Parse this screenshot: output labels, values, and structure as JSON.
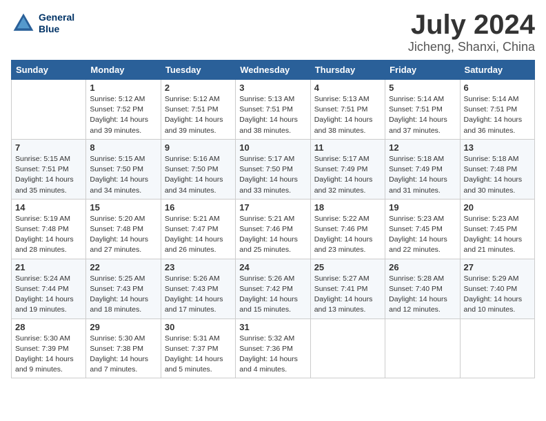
{
  "header": {
    "logo": {
      "line1": "General",
      "line2": "Blue"
    },
    "month": "July 2024",
    "location": "Jicheng, Shanxi, China"
  },
  "weekdays": [
    "Sunday",
    "Monday",
    "Tuesday",
    "Wednesday",
    "Thursday",
    "Friday",
    "Saturday"
  ],
  "weeks": [
    [
      {
        "day": "",
        "sunrise": "",
        "sunset": "",
        "daylight": ""
      },
      {
        "day": "1",
        "sunrise": "Sunrise: 5:12 AM",
        "sunset": "Sunset: 7:52 PM",
        "daylight": "Daylight: 14 hours and 39 minutes."
      },
      {
        "day": "2",
        "sunrise": "Sunrise: 5:12 AM",
        "sunset": "Sunset: 7:51 PM",
        "daylight": "Daylight: 14 hours and 39 minutes."
      },
      {
        "day": "3",
        "sunrise": "Sunrise: 5:13 AM",
        "sunset": "Sunset: 7:51 PM",
        "daylight": "Daylight: 14 hours and 38 minutes."
      },
      {
        "day": "4",
        "sunrise": "Sunrise: 5:13 AM",
        "sunset": "Sunset: 7:51 PM",
        "daylight": "Daylight: 14 hours and 38 minutes."
      },
      {
        "day": "5",
        "sunrise": "Sunrise: 5:14 AM",
        "sunset": "Sunset: 7:51 PM",
        "daylight": "Daylight: 14 hours and 37 minutes."
      },
      {
        "day": "6",
        "sunrise": "Sunrise: 5:14 AM",
        "sunset": "Sunset: 7:51 PM",
        "daylight": "Daylight: 14 hours and 36 minutes."
      }
    ],
    [
      {
        "day": "7",
        "sunrise": "Sunrise: 5:15 AM",
        "sunset": "Sunset: 7:51 PM",
        "daylight": "Daylight: 14 hours and 35 minutes."
      },
      {
        "day": "8",
        "sunrise": "Sunrise: 5:15 AM",
        "sunset": "Sunset: 7:50 PM",
        "daylight": "Daylight: 14 hours and 34 minutes."
      },
      {
        "day": "9",
        "sunrise": "Sunrise: 5:16 AM",
        "sunset": "Sunset: 7:50 PM",
        "daylight": "Daylight: 14 hours and 34 minutes."
      },
      {
        "day": "10",
        "sunrise": "Sunrise: 5:17 AM",
        "sunset": "Sunset: 7:50 PM",
        "daylight": "Daylight: 14 hours and 33 minutes."
      },
      {
        "day": "11",
        "sunrise": "Sunrise: 5:17 AM",
        "sunset": "Sunset: 7:49 PM",
        "daylight": "Daylight: 14 hours and 32 minutes."
      },
      {
        "day": "12",
        "sunrise": "Sunrise: 5:18 AM",
        "sunset": "Sunset: 7:49 PM",
        "daylight": "Daylight: 14 hours and 31 minutes."
      },
      {
        "day": "13",
        "sunrise": "Sunrise: 5:18 AM",
        "sunset": "Sunset: 7:48 PM",
        "daylight": "Daylight: 14 hours and 30 minutes."
      }
    ],
    [
      {
        "day": "14",
        "sunrise": "Sunrise: 5:19 AM",
        "sunset": "Sunset: 7:48 PM",
        "daylight": "Daylight: 14 hours and 28 minutes."
      },
      {
        "day": "15",
        "sunrise": "Sunrise: 5:20 AM",
        "sunset": "Sunset: 7:48 PM",
        "daylight": "Daylight: 14 hours and 27 minutes."
      },
      {
        "day": "16",
        "sunrise": "Sunrise: 5:21 AM",
        "sunset": "Sunset: 7:47 PM",
        "daylight": "Daylight: 14 hours and 26 minutes."
      },
      {
        "day": "17",
        "sunrise": "Sunrise: 5:21 AM",
        "sunset": "Sunset: 7:46 PM",
        "daylight": "Daylight: 14 hours and 25 minutes."
      },
      {
        "day": "18",
        "sunrise": "Sunrise: 5:22 AM",
        "sunset": "Sunset: 7:46 PM",
        "daylight": "Daylight: 14 hours and 23 minutes."
      },
      {
        "day": "19",
        "sunrise": "Sunrise: 5:23 AM",
        "sunset": "Sunset: 7:45 PM",
        "daylight": "Daylight: 14 hours and 22 minutes."
      },
      {
        "day": "20",
        "sunrise": "Sunrise: 5:23 AM",
        "sunset": "Sunset: 7:45 PM",
        "daylight": "Daylight: 14 hours and 21 minutes."
      }
    ],
    [
      {
        "day": "21",
        "sunrise": "Sunrise: 5:24 AM",
        "sunset": "Sunset: 7:44 PM",
        "daylight": "Daylight: 14 hours and 19 minutes."
      },
      {
        "day": "22",
        "sunrise": "Sunrise: 5:25 AM",
        "sunset": "Sunset: 7:43 PM",
        "daylight": "Daylight: 14 hours and 18 minutes."
      },
      {
        "day": "23",
        "sunrise": "Sunrise: 5:26 AM",
        "sunset": "Sunset: 7:43 PM",
        "daylight": "Daylight: 14 hours and 17 minutes."
      },
      {
        "day": "24",
        "sunrise": "Sunrise: 5:26 AM",
        "sunset": "Sunset: 7:42 PM",
        "daylight": "Daylight: 14 hours and 15 minutes."
      },
      {
        "day": "25",
        "sunrise": "Sunrise: 5:27 AM",
        "sunset": "Sunset: 7:41 PM",
        "daylight": "Daylight: 14 hours and 13 minutes."
      },
      {
        "day": "26",
        "sunrise": "Sunrise: 5:28 AM",
        "sunset": "Sunset: 7:40 PM",
        "daylight": "Daylight: 14 hours and 12 minutes."
      },
      {
        "day": "27",
        "sunrise": "Sunrise: 5:29 AM",
        "sunset": "Sunset: 7:40 PM",
        "daylight": "Daylight: 14 hours and 10 minutes."
      }
    ],
    [
      {
        "day": "28",
        "sunrise": "Sunrise: 5:30 AM",
        "sunset": "Sunset: 7:39 PM",
        "daylight": "Daylight: 14 hours and 9 minutes."
      },
      {
        "day": "29",
        "sunrise": "Sunrise: 5:30 AM",
        "sunset": "Sunset: 7:38 PM",
        "daylight": "Daylight: 14 hours and 7 minutes."
      },
      {
        "day": "30",
        "sunrise": "Sunrise: 5:31 AM",
        "sunset": "Sunset: 7:37 PM",
        "daylight": "Daylight: 14 hours and 5 minutes."
      },
      {
        "day": "31",
        "sunrise": "Sunrise: 5:32 AM",
        "sunset": "Sunset: 7:36 PM",
        "daylight": "Daylight: 14 hours and 4 minutes."
      },
      {
        "day": "",
        "sunrise": "",
        "sunset": "",
        "daylight": ""
      },
      {
        "day": "",
        "sunrise": "",
        "sunset": "",
        "daylight": ""
      },
      {
        "day": "",
        "sunrise": "",
        "sunset": "",
        "daylight": ""
      }
    ]
  ]
}
